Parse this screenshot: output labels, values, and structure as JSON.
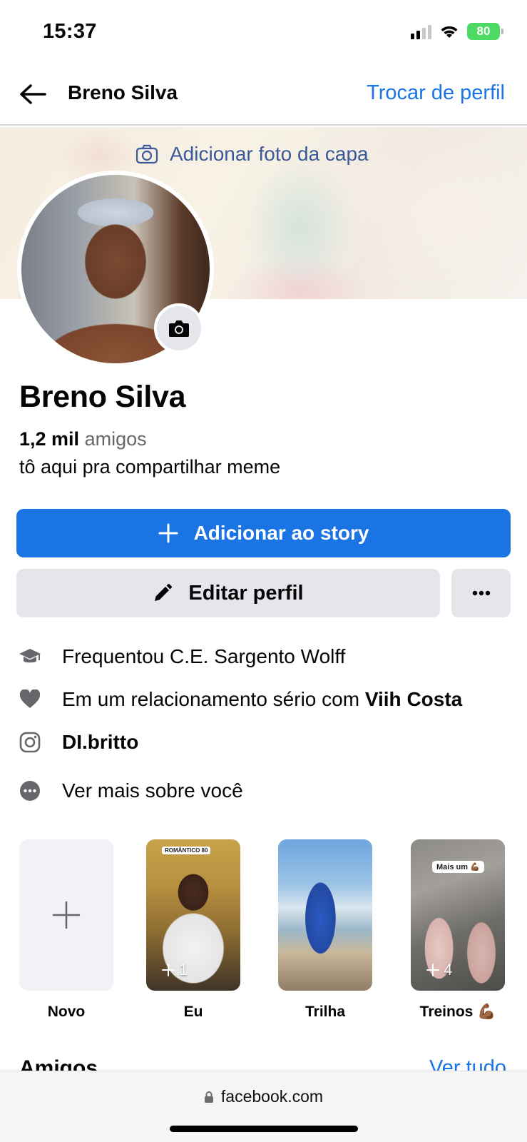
{
  "status_bar": {
    "time": "15:37",
    "battery": "80",
    "icons": [
      "signal-icon",
      "wifi-icon",
      "battery-icon"
    ]
  },
  "header": {
    "title": "Breno Silva",
    "switch_profile": "Trocar de perfil"
  },
  "cover": {
    "add_cover_label": "Adicionar foto da capa"
  },
  "profile": {
    "name": "Breno Silva",
    "friends_count": "1,2 mil",
    "friends_label": "amigos",
    "bio": "tô aqui pra compartilhar meme"
  },
  "actions": {
    "add_story": "Adicionar ao story",
    "edit_profile": "Editar perfil"
  },
  "details": [
    {
      "icon": "graduation-cap-icon",
      "text": "Frequentou C.E. Sargento Wolff"
    },
    {
      "icon": "heart-icon",
      "prefix": "Em um relacionamento sério com ",
      "bold": "Viih Costa"
    },
    {
      "icon": "instagram-icon",
      "bold": "DI.britto"
    },
    {
      "icon": "more-circle-icon",
      "text": "Ver mais sobre você"
    }
  ],
  "highlights": [
    {
      "label": "Novo"
    },
    {
      "label": "Eu",
      "count": "1",
      "sticker": "ROMÂNTICO 80"
    },
    {
      "label": "Trilha"
    },
    {
      "label": "Treinos 💪🏾",
      "count": "4",
      "sticker": "Mais um 💪🏾"
    }
  ],
  "friends_section": {
    "title": "Amigos",
    "see_all": "Ver tudo"
  },
  "browser": {
    "url": "facebook.com"
  },
  "colors": {
    "accent": "#1b74e4",
    "button_gray": "#e4e6eb",
    "secondary_text": "#65676b"
  }
}
